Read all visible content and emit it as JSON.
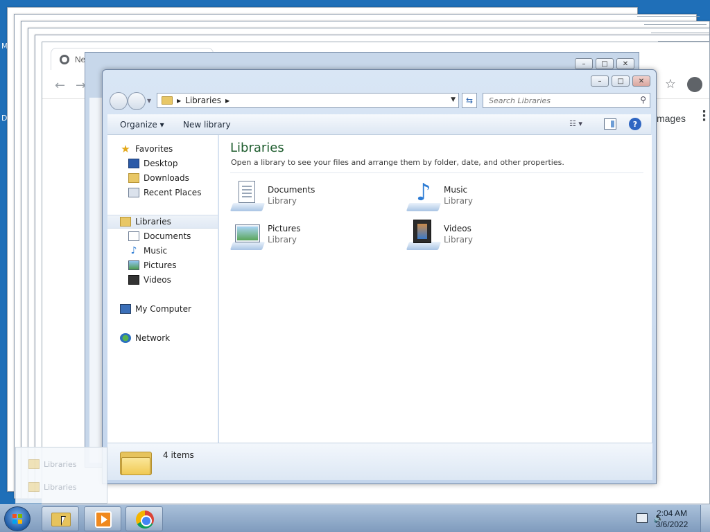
{
  "desktop": {
    "fragment_left_top": "M",
    "fragment_left_mid": "D"
  },
  "chrome": {
    "tab_title": "Ne",
    "images_link": "Images"
  },
  "explorer": {
    "address_crumb": "Libraries",
    "search_placeholder": "Search Libraries",
    "toolbar": {
      "organize": "Organize",
      "organize_caret": "▾",
      "new_library": "New library"
    },
    "nav": {
      "favorites": "Favorites",
      "desktop": "Desktop",
      "downloads": "Downloads",
      "recent_places": "Recent Places",
      "libraries": "Libraries",
      "documents": "Documents",
      "music": "Music",
      "pictures": "Pictures",
      "videos": "Videos",
      "my_computer": "My Computer",
      "network": "Network"
    },
    "content": {
      "title": "Libraries",
      "subtitle": "Open a library to see your files and arrange them by folder, date, and other properties.",
      "items": [
        {
          "name": "Documents",
          "kind": "Library"
        },
        {
          "name": "Music",
          "kind": "Library"
        },
        {
          "name": "Pictures",
          "kind": "Library"
        },
        {
          "name": "Videos",
          "kind": "Library"
        }
      ]
    },
    "status": {
      "item_count": "4 items"
    }
  },
  "thumbnails": [
    {
      "label": "Libraries"
    },
    {
      "label": "Libraries"
    }
  ],
  "taskbar": {
    "clock_time": "2:04 AM",
    "clock_date": "3/6/2022"
  }
}
